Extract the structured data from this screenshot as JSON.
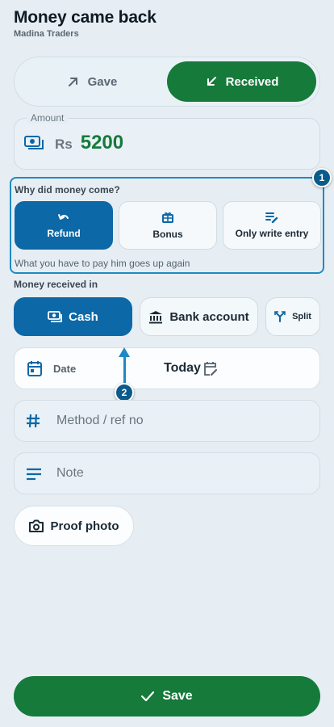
{
  "header": {
    "title": "Money came back",
    "subtitle": "Madina Traders"
  },
  "direction_toggle": {
    "gave_label": "Gave",
    "received_label": "Received",
    "selected": "Received"
  },
  "amount": {
    "legend": "Amount",
    "currency": "Rs",
    "value": "5200"
  },
  "reason": {
    "label": "Why did money come?",
    "options": [
      {
        "label": "Refund",
        "icon": "undo-icon",
        "selected": true
      },
      {
        "label": "Bonus",
        "icon": "gift-icon",
        "selected": false
      },
      {
        "label": "Only write entry",
        "icon": "edit-list-icon",
        "selected": false
      }
    ],
    "hint": "What you have to pay him goes up again"
  },
  "annotations": {
    "marker_1": "1",
    "marker_2": "2"
  },
  "payment": {
    "label": "Money received in",
    "options": [
      {
        "label": "Cash",
        "icon": "cash-icon",
        "selected": true
      },
      {
        "label": "Bank account",
        "icon": "bank-icon",
        "selected": false
      },
      {
        "label": "Split",
        "icon": "split-icon",
        "selected": false
      }
    ]
  },
  "date_field": {
    "label": "Date",
    "value": "Today"
  },
  "method_field": {
    "placeholder": "Method / ref no",
    "icon": "hash-icon"
  },
  "note_field": {
    "placeholder": "Note",
    "icon": "notes-icon"
  },
  "proof_button": {
    "label": "Proof photo",
    "icon": "camera-icon"
  },
  "save_button": {
    "label": "Save",
    "icon": "check-icon"
  },
  "colors": {
    "accent_green": "#157a3a",
    "accent_blue": "#0c68a6",
    "highlight": "#1e8ac4",
    "background": "#e6eef4"
  }
}
